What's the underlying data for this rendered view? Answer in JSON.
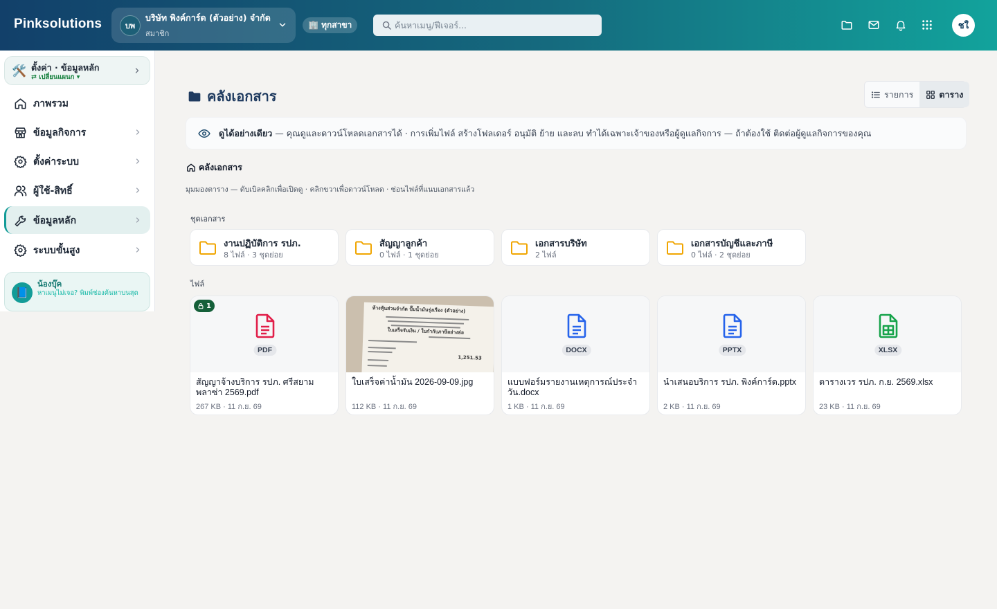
{
  "topbar": {
    "brand": "Pinksolutions",
    "company_badge": "บพ",
    "company_name": "บริษัท พิงค์การ์ด (ตัวอย่าง) จำกัด",
    "company_role": "สมาชิก",
    "branch_label": "🏢 ทุกสาขา",
    "search_placeholder": "ค้นหาเมนู/ฟีเจอร์...",
    "avatar_initials": "ชใ",
    "icons": [
      "folder-icon",
      "mail-icon",
      "bell-icon",
      "apps-grid-icon"
    ]
  },
  "sidebar": {
    "top_card": {
      "title": "ตั้งค่า · ข้อมูลหลัก",
      "subtitle": "⇄ เปลี่ยนแผนก ▾"
    },
    "items": [
      {
        "label": "ภาพรวม",
        "icon": "home-icon",
        "has_chevron": false,
        "active": false
      },
      {
        "label": "ข้อมูลกิจการ",
        "icon": "store-icon",
        "has_chevron": true,
        "active": false
      },
      {
        "label": "ตั้งค่าระบบ",
        "icon": "gear-icon",
        "has_chevron": true,
        "active": false
      },
      {
        "label": "ผู้ใช้-สิทธิ์",
        "icon": "users-icon",
        "has_chevron": true,
        "active": false
      },
      {
        "label": "ข้อมูลหลัก",
        "icon": "wrench-icon",
        "has_chevron": true,
        "active": true
      },
      {
        "label": "ระบบขั้นสูง",
        "icon": "gear-icon",
        "has_chevron": true,
        "active": false
      }
    ],
    "helper": {
      "title": "น้องบุ๊ค",
      "text": "หาเมนูไม่เจอ? พิมพ์ช่องค้นหาบนสุด"
    }
  },
  "main": {
    "title": "คลังเอกสาร",
    "view_toggle": {
      "list_label": "รายการ",
      "grid_label": "ตาราง",
      "selected": "grid"
    },
    "notice": {
      "bold": "ดูได้อย่างเดียว",
      "text": " — คุณดูและดาวน์โหลดเอกสารได้ · การเพิ่มไฟล์ สร้างโฟลเดอร์ อนุมัติ ย้าย และลบ ทำได้เฉพาะเจ้าของหรือผู้ดูแลกิจการ — ถ้าต้องใช้ ติดต่อผู้ดูแลกิจการของคุณ"
    },
    "breadcrumb": "คลังเอกสาร",
    "hint": "มุมมองตาราง — ดับเบิลคลิกเพื่อเปิดดู · คลิกขวาเพื่อดาวน์โหลด · ซ่อนไฟล์ที่แนบเอกสารแล้ว",
    "folders_label": "ชุดเอกสาร",
    "folders": [
      {
        "name": "งานปฏิบัติการ รปภ.",
        "meta": "8 ไฟล์ · 3 ชุดย่อย"
      },
      {
        "name": "สัญญาลูกค้า",
        "meta": "0 ไฟล์ · 1 ชุดย่อย"
      },
      {
        "name": "เอกสารบริษัท",
        "meta": "2 ไฟล์"
      },
      {
        "name": "เอกสารบัญชีและภาษี",
        "meta": "0 ไฟล์ · 2 ชุดย่อย"
      }
    ],
    "files_label": "ไฟล์",
    "files": [
      {
        "name": "สัญญาจ้างบริการ รปภ. ศรีสยาม พลาซ่า 2569.pdf",
        "meta": "267 KB · 11 ก.ย. 69",
        "ext": "PDF",
        "color": "#e11d48",
        "lock_count": "1",
        "thumb": "icon"
      },
      {
        "name": "ใบเสร็จค่าน้ำมัน 2026-09-09.jpg",
        "meta": "112 KB · 11 ก.ย. 69",
        "ext": "",
        "color": "",
        "lock_count": "",
        "thumb": "photo",
        "photo_text": [
          "ห้างหุ้นส่วนจำกัด ปั๊มน้ำมันรุ่งเรือง (ตัวอย่าง)",
          "ใบเสร็จรับเงิน / ใบกำกับภาษีอย่างย่อ",
          "1,251.53"
        ]
      },
      {
        "name": "แบบฟอร์มรายงานเหตุการณ์ประจำวัน.docx",
        "meta": "1 KB · 11 ก.ย. 69",
        "ext": "DOCX",
        "color": "#2563eb",
        "lock_count": "",
        "thumb": "icon"
      },
      {
        "name": "นำเสนอบริการ รปภ. พิงค์การ์ด.pptx",
        "meta": "2 KB · 11 ก.ย. 69",
        "ext": "PPTX",
        "color": "#2563eb",
        "lock_count": "",
        "thumb": "icon"
      },
      {
        "name": "ตารางเวร รปภ. ก.ย. 2569.xlsx",
        "meta": "23 KB · 11 ก.ย. 69",
        "ext": "XLSX",
        "color": "#16a34a",
        "lock_count": "",
        "thumb": "icon"
      }
    ]
  }
}
